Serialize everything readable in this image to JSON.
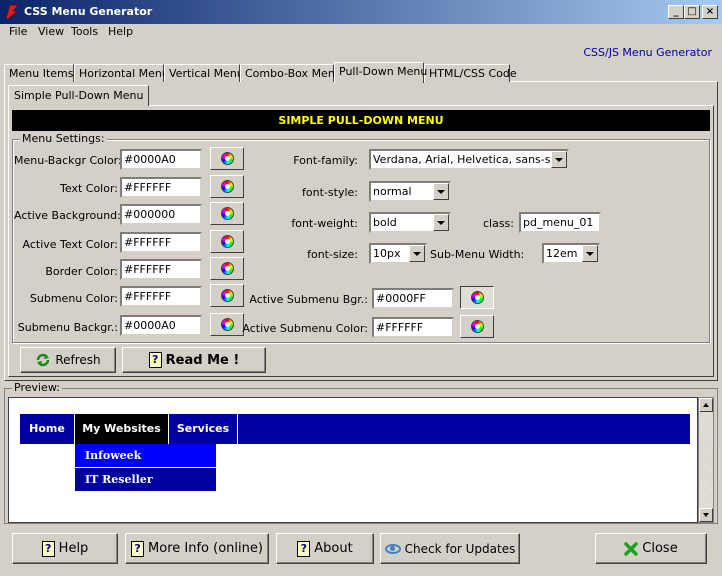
{
  "window": {
    "title": "CSS Menu Generator",
    "controls": [
      "_",
      "□",
      "×"
    ]
  },
  "menubar": [
    "File",
    "View",
    "Tools",
    "Help"
  ],
  "brand": "CSS/JS Menu Generator",
  "tabs": [
    "Menu Items",
    "Horizontal Menu",
    "Vertical Menu",
    "Combo-Box Menu",
    "Pull-Down Menu",
    "HTML/CSS Code"
  ],
  "active_tab": "Pull-Down Menu",
  "subtab": "Simple Pull-Down Menu",
  "banner": "SIMPLE PULL-DOWN MENU",
  "settings": {
    "group_title": "Menu Settings:",
    "colors": [
      {
        "label": "Menu-Backgr Color:",
        "value": "#0000A0"
      },
      {
        "label": "Text Color:",
        "value": "#FFFFFF"
      },
      {
        "label": "Active Background:",
        "value": "#000000"
      },
      {
        "label": "Active Text Color:",
        "value": "#FFFFFF"
      },
      {
        "label": "Border Color:",
        "value": "#FFFFFF"
      },
      {
        "label": "Submenu Color:",
        "value": "#FFFFFF"
      },
      {
        "label": "Submenu Backgr.:",
        "value": "#0000A0"
      }
    ],
    "font_family_label": "Font-family:",
    "font_family": "Verdana, Arial, Helvetica, sans-serif",
    "font_style_label": "font-style:",
    "font_style": "normal",
    "font_weight_label": "font-weight:",
    "font_weight": "bold",
    "class_label": "class:",
    "class_value": "pd_menu_01",
    "font_size_label": "font-size:",
    "font_size": "10px",
    "submenu_width_label": "Sub-Menu Width:",
    "submenu_width": "12em",
    "active_submenu_bgr_label": "Active Submenu Bgr.:",
    "active_submenu_bgr": "#0000FF",
    "active_submenu_color_label": "Active Submenu Color:",
    "active_submenu_color": "#FFFFFF"
  },
  "buttons": {
    "refresh": "Refresh",
    "readme": "Read Me !"
  },
  "preview": {
    "title": "Preview:",
    "menu": [
      "Home",
      "My Websites",
      "Services"
    ],
    "active_item": "My Websites",
    "submenu": [
      "Infoweek",
      "IT Reseller"
    ],
    "menu_bg": "#0000A0",
    "active_bg": "#000000",
    "active_sub_bg": "#0000FF"
  },
  "bottom": {
    "help": "Help",
    "more_info": "More Info (online)",
    "about": "About",
    "updates": "Check for Updates",
    "close": "Close"
  }
}
